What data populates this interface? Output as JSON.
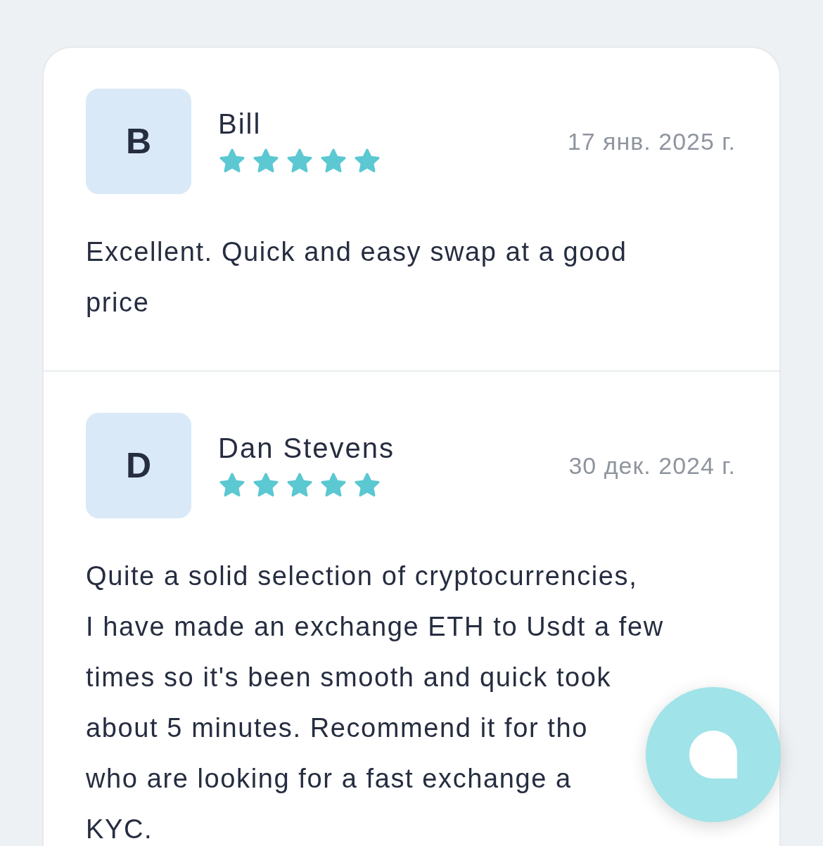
{
  "reviews": [
    {
      "avatar_letter": "B",
      "name": "Bill",
      "stars": 5,
      "date": "17 янв. 2025 г.",
      "text_lines": [
        "Excellent. Quick and easy swap at a good",
        "price"
      ]
    },
    {
      "avatar_letter": "D",
      "name": "Dan Stevens",
      "stars": 5,
      "date": "30 дек. 2024 г.",
      "text_lines": [
        "Quite a solid selection of cryptocurrencies,",
        "I have made an exchange ETH to Usdt a few",
        "times so it's been smooth and quick took",
        "about 5 minutes. Recommend it for tho",
        "who are looking for a fast exchange a",
        "KYC."
      ]
    }
  ]
}
